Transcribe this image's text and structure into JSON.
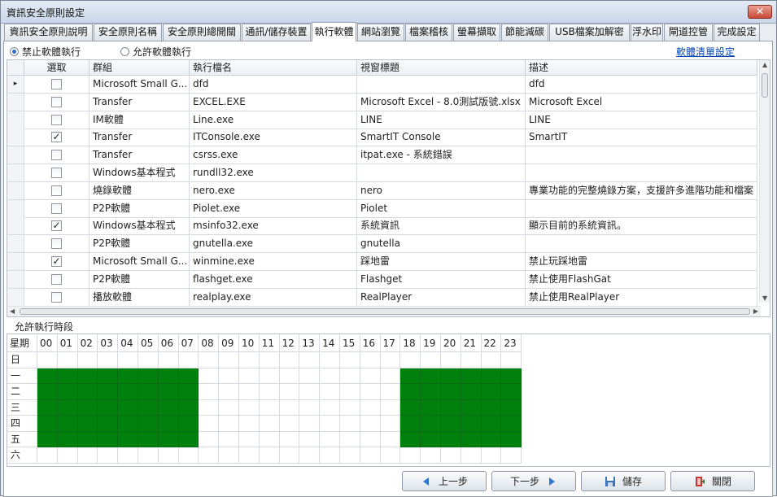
{
  "window": {
    "title": "資訊安全原則設定",
    "close_label": "✕"
  },
  "tabs": [
    {
      "label": "資訊安全原則說明"
    },
    {
      "label": "安全原則名稱"
    },
    {
      "label": "安全原則總開關"
    },
    {
      "label": "通訊/儲存裝置"
    },
    {
      "label": "執行軟體"
    },
    {
      "label": "網站瀏覽"
    },
    {
      "label": "檔案稽核"
    },
    {
      "label": "螢幕擷取"
    },
    {
      "label": "節能減碳"
    },
    {
      "label": "USB檔案加解密"
    },
    {
      "label": "浮水印"
    },
    {
      "label": "閘道控管"
    },
    {
      "label": "完成設定"
    }
  ],
  "active_tab": "執行軟體",
  "mode": {
    "block_label": "禁止軟體執行",
    "allow_label": "允許軟體執行",
    "selected": "block"
  },
  "list_link": "軟體清單設定",
  "grid": {
    "columns": [
      "",
      "選取",
      "群組",
      "執行檔名",
      "視窗標題",
      "描述"
    ],
    "rows": [
      {
        "marker": "▸",
        "checked": false,
        "group": "Microsoft Small G...",
        "exe": "dfd",
        "title": "",
        "desc": "dfd"
      },
      {
        "marker": "",
        "checked": false,
        "group": "Transfer",
        "exe": "EXCEL.EXE",
        "title": "Microsoft Excel - 8.0測試版號.xlsx",
        "desc": "Microsoft Excel"
      },
      {
        "marker": "",
        "checked": false,
        "group": "IM軟體",
        "exe": "Line.exe",
        "title": "LINE",
        "desc": "LINE"
      },
      {
        "marker": "",
        "checked": true,
        "group": "Transfer",
        "exe": "ITConsole.exe",
        "title": "SmartIT Console",
        "desc": "SmartIT"
      },
      {
        "marker": "",
        "checked": false,
        "group": "Transfer",
        "exe": "csrss.exe",
        "title": "itpat.exe - 系統錯誤",
        "desc": ""
      },
      {
        "marker": "",
        "checked": false,
        "group": "Windows基本程式",
        "exe": "rundll32.exe",
        "title": "",
        "desc": ""
      },
      {
        "marker": "",
        "checked": false,
        "group": "燒錄軟體",
        "exe": "nero.exe",
        "title": "nero",
        "desc": "專業功能的完整燒錄方案，支援許多進階功能和檔案"
      },
      {
        "marker": "",
        "checked": false,
        "group": "P2P軟體",
        "exe": "Piolet.exe",
        "title": "Piolet",
        "desc": ""
      },
      {
        "marker": "",
        "checked": true,
        "group": "Windows基本程式",
        "exe": "msinfo32.exe",
        "title": "系統資訊",
        "desc": "顯示目前的系統資訊。"
      },
      {
        "marker": "",
        "checked": false,
        "group": "P2P軟體",
        "exe": "gnutella.exe",
        "title": "gnutella",
        "desc": ""
      },
      {
        "marker": "",
        "checked": true,
        "group": "Microsoft Small G...",
        "exe": "winmine.exe",
        "title": "踩地雷",
        "desc": "禁止玩踩地雷"
      },
      {
        "marker": "",
        "checked": false,
        "group": "P2P軟體",
        "exe": "flashget.exe",
        "title": "Flashget",
        "desc": "禁止使用FlashGat"
      },
      {
        "marker": "",
        "checked": false,
        "group": "播放軟體",
        "exe": "realplay.exe",
        "title": "RealPlayer",
        "desc": "禁止使用RealPlayer"
      }
    ]
  },
  "schedule": {
    "label": "允許執行時段",
    "corner": "星期",
    "hours": [
      "00",
      "01",
      "02",
      "03",
      "04",
      "05",
      "06",
      "07",
      "08",
      "09",
      "10",
      "11",
      "12",
      "13",
      "14",
      "15",
      "16",
      "17",
      "18",
      "19",
      "20",
      "21",
      "22",
      "23"
    ],
    "days": [
      "日",
      "一",
      "二",
      "三",
      "四",
      "五",
      "六"
    ],
    "on": [
      [],
      [
        0,
        1,
        2,
        3,
        4,
        5,
        6,
        7,
        18,
        19,
        20,
        21,
        22,
        23
      ],
      [
        0,
        1,
        2,
        3,
        4,
        5,
        6,
        7,
        18,
        19,
        20,
        21,
        22,
        23
      ],
      [
        0,
        1,
        2,
        3,
        4,
        5,
        6,
        7,
        18,
        19,
        20,
        21,
        22,
        23
      ],
      [
        0,
        1,
        2,
        3,
        4,
        5,
        6,
        7,
        18,
        19,
        20,
        21,
        22,
        23
      ],
      [
        0,
        1,
        2,
        3,
        4,
        5,
        6,
        7,
        18,
        19,
        20,
        21,
        22,
        23
      ],
      []
    ],
    "on_color": "#00800d"
  },
  "buttons": {
    "prev": "上一步",
    "next": "下一步",
    "save": "儲存",
    "close": "關閉"
  }
}
